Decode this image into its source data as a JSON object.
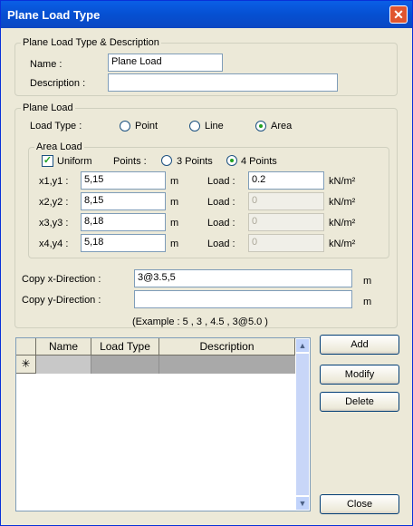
{
  "window": {
    "title": "Plane Load Type"
  },
  "desc_group": {
    "label": "Plane Load Type & Description",
    "name_label": "Name :",
    "name_value": "Plane Load",
    "desc_label": "Description :",
    "desc_value": ""
  },
  "plane_load": {
    "label": "Plane Load",
    "load_type_label": "Load Type :",
    "options": [
      "Point",
      "Line",
      "Area"
    ],
    "selected": "Area"
  },
  "area_load": {
    "label": "Area Load",
    "uniform_label": "Uniform",
    "uniform_checked": true,
    "points_label": "Points :",
    "point_options": [
      "3 Points",
      "4 Points"
    ],
    "point_selected": "4 Points",
    "rows": [
      {
        "label": "x1,y1 :",
        "coord": "5,15",
        "unit": "m",
        "load_label": "Load :",
        "load": "0.2",
        "load_enabled": true,
        "load_unit": "kN/m²"
      },
      {
        "label": "x2,y2 :",
        "coord": "8,15",
        "unit": "m",
        "load_label": "Load :",
        "load": "0",
        "load_enabled": false,
        "load_unit": "kN/m²"
      },
      {
        "label": "x3,y3 :",
        "coord": "8,18",
        "unit": "m",
        "load_label": "Load :",
        "load": "0",
        "load_enabled": false,
        "load_unit": "kN/m²"
      },
      {
        "label": "x4,y4 :",
        "coord": "5,18",
        "unit": "m",
        "load_label": "Load :",
        "load": "0",
        "load_enabled": false,
        "load_unit": "kN/m²"
      }
    ]
  },
  "copy": {
    "x_label": "Copy x-Direction :",
    "x_value": "3@3.5,5",
    "x_unit": "m",
    "y_label": "Copy y-Direction :",
    "y_value": "",
    "y_unit": "m",
    "example": "(Example : 5 , 3 , 4.5 , 3@5.0 )"
  },
  "grid": {
    "columns": [
      "",
      "Name",
      "Load Type",
      "Description"
    ],
    "new_row_marker": "✳"
  },
  "buttons": {
    "add": "Add",
    "modify": "Modify",
    "delete": "Delete",
    "close": "Close"
  },
  "icons": {
    "close": "close-icon",
    "scroll_up": "chevron-up-icon",
    "scroll_down": "chevron-down-icon"
  },
  "colors": {
    "titlebar": "#0a5fe6",
    "close_button": "#e0552f",
    "window_bg": "#ece9d8",
    "selected_row": "#a9a9a9",
    "radio_dot": "#21a121"
  }
}
